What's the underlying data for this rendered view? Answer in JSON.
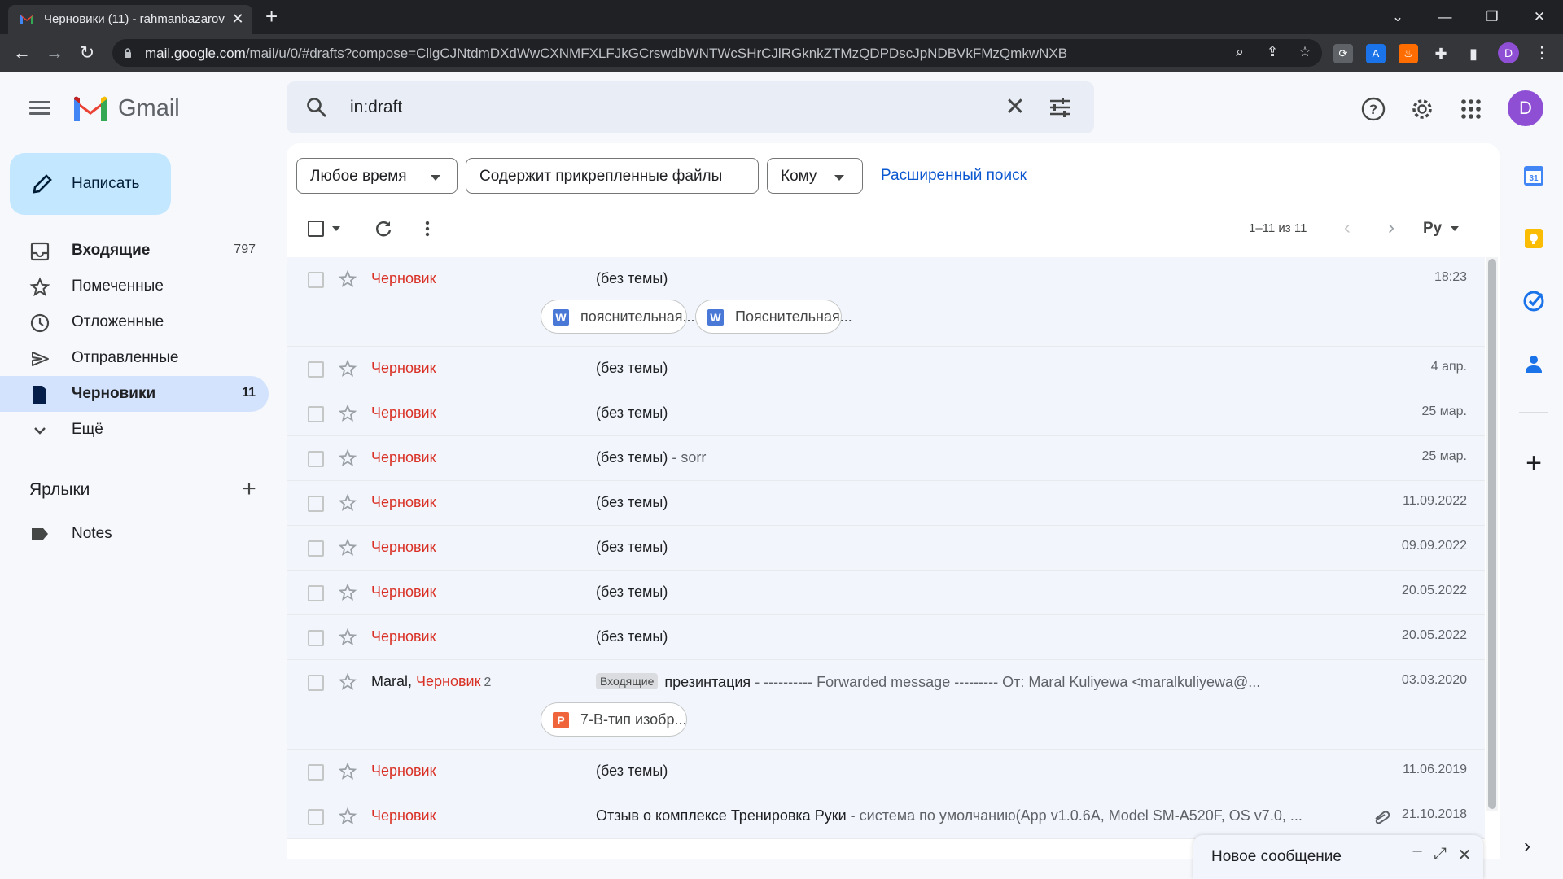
{
  "browser": {
    "tab_title": "Черновики (11) - rahmanbazarov",
    "url_host": "mail.google.com",
    "url_path": "/mail/u/0/#drafts?compose=CllgCJNtdmDXdWwCXNMFXLFJkGCrswdbWNTWcSHrCJlRGknkZTMzQDPDscJpNDBVkFMzQmkwNXB",
    "profile_initial": "D"
  },
  "gmail": {
    "product_name": "Gmail",
    "account_initial": "D"
  },
  "search": {
    "query": "in:draft"
  },
  "compose": {
    "label": "Написать"
  },
  "nav": [
    {
      "label": "Входящие",
      "count": "797",
      "icon": "inbox-icon"
    },
    {
      "label": "Помеченные",
      "count": "",
      "icon": "star-icon"
    },
    {
      "label": "Отложенные",
      "count": "",
      "icon": "clock-icon"
    },
    {
      "label": "Отправленные",
      "count": "",
      "icon": "send-icon"
    },
    {
      "label": "Черновики",
      "count": "11",
      "icon": "draft-icon"
    },
    {
      "label": "Ещё",
      "count": "",
      "icon": "chevron-down-icon"
    }
  ],
  "labels": {
    "title": "Ярлыки",
    "items": [
      {
        "label": "Notes"
      }
    ]
  },
  "filters": {
    "time": "Любое время",
    "has_attachment": "Содержит прикрепленные файлы",
    "to": "Кому",
    "advanced": "Расширенный поиск"
  },
  "toolbar": {
    "pagination": "1–11 из 11",
    "input_tools": "Ру"
  },
  "emails": [
    {
      "sender": "",
      "draft_label": "Черновик",
      "count": "",
      "tag": "",
      "subject": "(без темы)",
      "snippet": "",
      "date": "18:23",
      "attachments": [
        {
          "name": "пояснительная...",
          "type": "W"
        },
        {
          "name": "Пояснительная...",
          "type": "W"
        }
      ]
    },
    {
      "sender": "",
      "draft_label": "Черновик",
      "count": "",
      "tag": "",
      "subject": "(без темы)",
      "snippet": "",
      "date": "4 апр."
    },
    {
      "sender": "",
      "draft_label": "Черновик",
      "count": "",
      "tag": "",
      "subject": "(без темы)",
      "snippet": "",
      "date": "25 мар."
    },
    {
      "sender": "",
      "draft_label": "Черновик",
      "count": "",
      "tag": "",
      "subject": "(без темы)",
      "snippet": " - sorr",
      "date": "25 мар."
    },
    {
      "sender": "",
      "draft_label": "Черновик",
      "count": "",
      "tag": "",
      "subject": "(без темы)",
      "snippet": "",
      "date": "11.09.2022"
    },
    {
      "sender": "",
      "draft_label": "Черновик",
      "count": "",
      "tag": "",
      "subject": "(без темы)",
      "snippet": "",
      "date": "09.09.2022"
    },
    {
      "sender": "",
      "draft_label": "Черновик",
      "count": "",
      "tag": "",
      "subject": "(без темы)",
      "snippet": "",
      "date": "20.05.2022"
    },
    {
      "sender": "",
      "draft_label": "Черновик",
      "count": "",
      "tag": "",
      "subject": "(без темы)",
      "snippet": "",
      "date": "20.05.2022"
    },
    {
      "sender": "Maral, ",
      "draft_label": "Черновик",
      "count": "2",
      "tag": "Входящие",
      "subject": "презинтация",
      "snippet": " - ---------- Forwarded message --------- От: Maral Kuliyewa <maralkuliyewa@...",
      "date": "03.03.2020",
      "attachments": [
        {
          "name": "7-B-тип изобр...",
          "type": "P"
        }
      ]
    },
    {
      "sender": "",
      "draft_label": "Черновик",
      "count": "",
      "tag": "",
      "subject": "(без темы)",
      "snippet": "",
      "date": "11.06.2019"
    },
    {
      "sender": "",
      "draft_label": "Черновик",
      "count": "",
      "tag": "",
      "subject": "Отзыв о комплексе Тренировка Руки",
      "snippet": " - система по умолчанию(App v1.0.6A, Model SM-A520F, OS v7.0, ...",
      "date": "21.10.2018",
      "has_clip": true
    }
  ],
  "compose_window": {
    "title": "Новое сообщение"
  },
  "colors": {
    "draft_red": "#d93025",
    "link_blue": "#0b57d0",
    "compose_bg": "#c2e7ff",
    "active_nav": "#d3e3fd",
    "avatar_purple": "#8e4fd4",
    "word_blue": "#4a78d6",
    "ppt_orange": "#f0643c"
  }
}
